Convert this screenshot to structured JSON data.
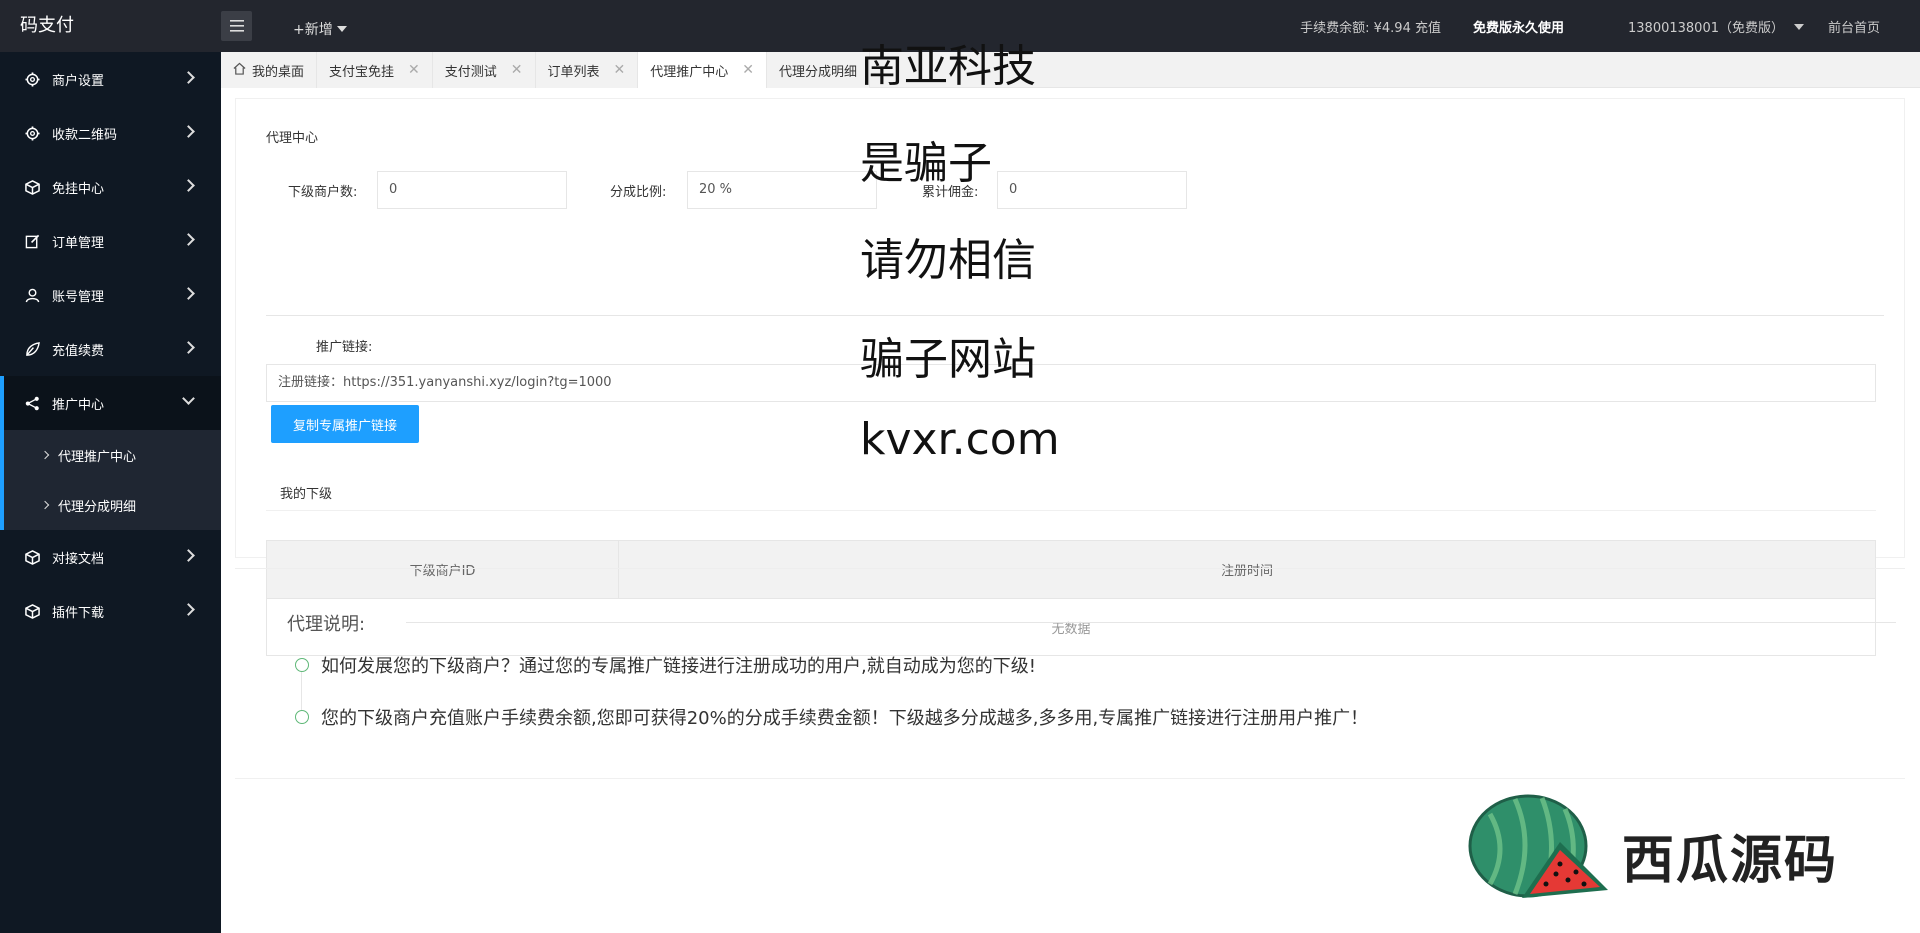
{
  "header": {
    "logo": "码支付",
    "new_label": "+新增",
    "balance": "手续费余额: ¥4.94 充值",
    "free": "免费版永久使用",
    "user": "13800138001（免费版）",
    "home": "前台首页"
  },
  "sidebar": {
    "items": [
      {
        "label": "商户设置",
        "icon": "gear-icon"
      },
      {
        "label": "收款二维码",
        "icon": "gear-icon"
      },
      {
        "label": "免挂中心",
        "icon": "cube-icon"
      },
      {
        "label": "订单管理",
        "icon": "edit-icon"
      },
      {
        "label": "账号管理",
        "icon": "user-icon"
      },
      {
        "label": "充值续费",
        "icon": "leaf-icon"
      },
      {
        "label": "推广中心",
        "icon": "share-icon"
      },
      {
        "label": "对接文档",
        "icon": "cube-icon"
      },
      {
        "label": "插件下载",
        "icon": "cube-icon"
      }
    ],
    "subitems": [
      {
        "label": "代理推广中心"
      },
      {
        "label": "代理分成明细"
      }
    ]
  },
  "tabs": [
    {
      "label": "我的桌面"
    },
    {
      "label": "支付宝免挂"
    },
    {
      "label": "支付测试"
    },
    {
      "label": "订单列表"
    },
    {
      "label": "代理推广中心"
    },
    {
      "label": "代理分成明细"
    }
  ],
  "panel": {
    "title": "代理中心",
    "sub_count_label": "下级商户数:",
    "sub_count_value": "0",
    "ratio_label": "分成比例:",
    "ratio_value": "20 %",
    "total_label": "累计佣金:",
    "total_value": "0",
    "promo_label": "推广链接:",
    "link_text": "注册链接：https://351.yanyanshi.xyz/login?tg=1000",
    "copy_button": "复制专属推广链接",
    "my_sub_title": "我的下级",
    "table": {
      "columns": [
        "下级商户ID",
        "注册时间"
      ],
      "empty": "无数据"
    }
  },
  "explain": {
    "title": "代理说明:",
    "items": [
      "如何发展您的下级商户？通过您的专属推广链接进行注册成功的用户,就自动成为您的下级!",
      "您的下级商户充值账户手续费余额,您即可获得20%的分成手续费金额！下级越多分成越多,多多用,专属推广链接进行注册用户推广！"
    ]
  },
  "overlay": {
    "lines": [
      "南亚科技",
      "是骗子",
      "请勿相信",
      "骗子网站",
      "kvxr.com"
    ]
  },
  "brand": {
    "text": "西瓜源码"
  }
}
